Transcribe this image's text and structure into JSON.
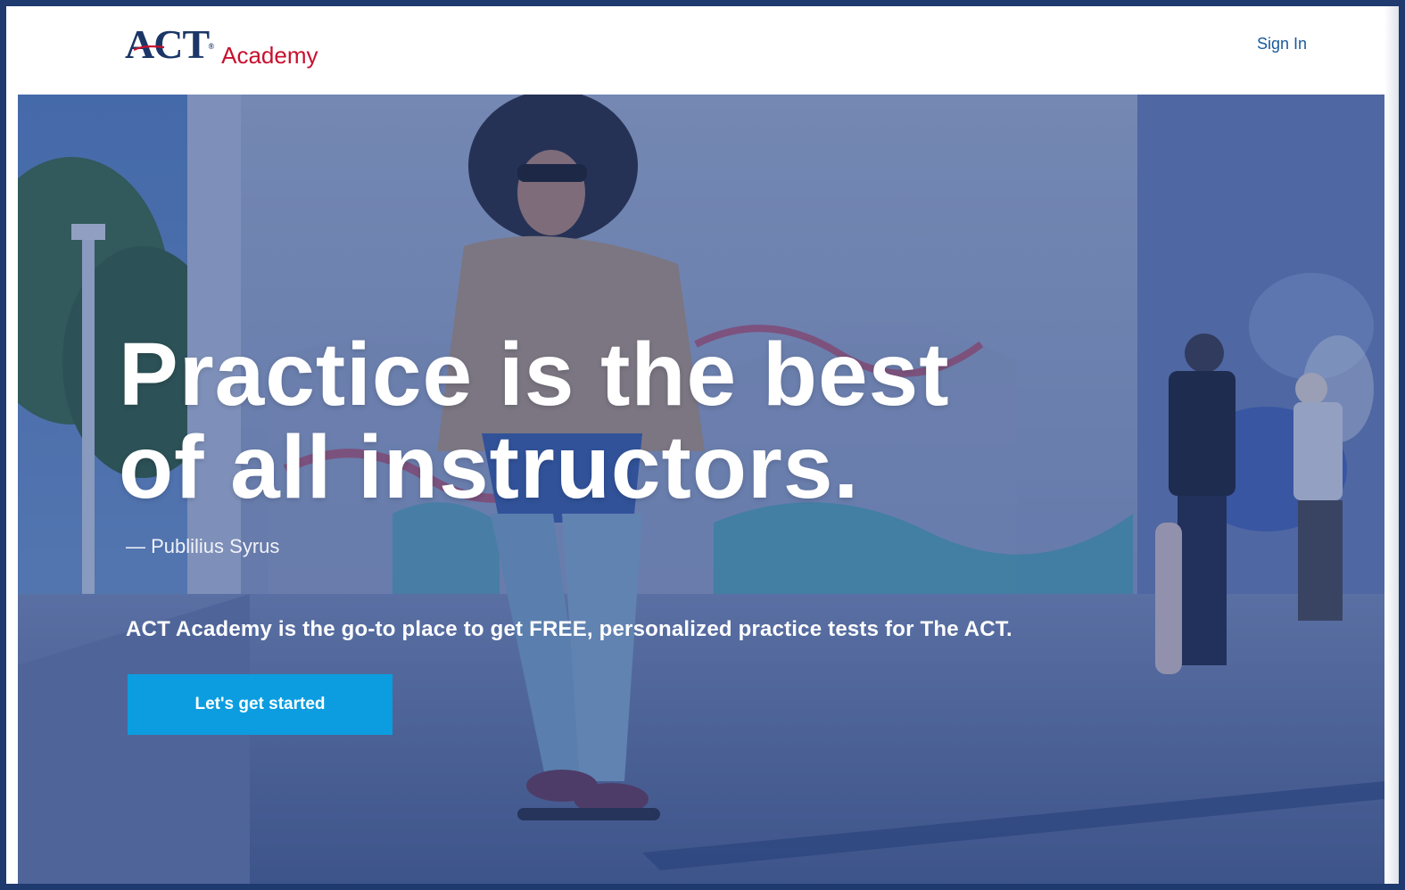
{
  "header": {
    "logo_act": "ACT",
    "logo_tm": "®",
    "logo_academy": "Academy",
    "sign_in_label": "Sign In"
  },
  "hero": {
    "headline_line1": "Practice is the best",
    "headline_line2": "of all instructors.",
    "attribution": "— Publilius Syrus",
    "tagline": "ACT Academy is the go-to place to get FREE, personalized practice tests for The ACT.",
    "cta_label": "Let's get started"
  },
  "colors": {
    "frame_border": "#1e3a6e",
    "logo_navy": "#1b3667",
    "logo_red": "#c8102e",
    "sign_in": "#1b5a9c",
    "cta_blue": "#0b9de0",
    "hero_overlay": "#203c80"
  }
}
